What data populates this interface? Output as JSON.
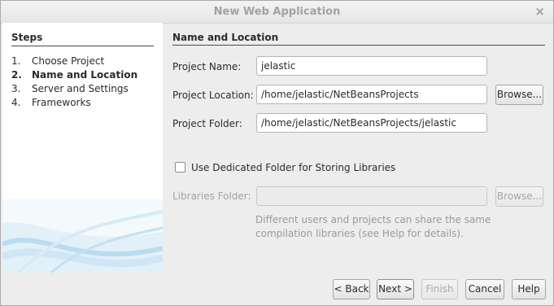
{
  "window": {
    "title": "New Web Application",
    "close_glyph": "×"
  },
  "steps": {
    "heading": "Steps",
    "items": [
      {
        "num": "1.",
        "label": "Choose Project",
        "current": false
      },
      {
        "num": "2.",
        "label": "Name and Location",
        "current": true
      },
      {
        "num": "3.",
        "label": "Server and Settings",
        "current": false
      },
      {
        "num": "4.",
        "label": "Frameworks",
        "current": false
      }
    ]
  },
  "main": {
    "section_title": "Name and Location",
    "project_name": {
      "label": "Project Name:",
      "value": "jelastic"
    },
    "project_location": {
      "label": "Project Location:",
      "value": "/home/jelastic/NetBeansProjects",
      "browse_label": "Browse..."
    },
    "project_folder": {
      "label": "Project Folder:",
      "value": "/home/jelastic/NetBeansProjects/jelastic"
    },
    "dedicated_folder": {
      "label": "Use Dedicated Folder for Storing Libraries",
      "checked": false
    },
    "libraries_folder": {
      "label": "Libraries Folder:",
      "value": "",
      "browse_label": "Browse..."
    },
    "hint_lines": [
      "Different users and projects can share the same",
      "compilation libraries (see Help for details)."
    ]
  },
  "footer": {
    "back_label": "< Back",
    "next_label": "Next >",
    "finish_label": "Finish",
    "cancel_label": "Cancel",
    "help_label": "Help"
  },
  "colors": {
    "window_bg": "#ededed",
    "panel_bg": "#ffffff",
    "disabled_text": "#a3a3a3",
    "wave_accent": "#b9dcef"
  }
}
